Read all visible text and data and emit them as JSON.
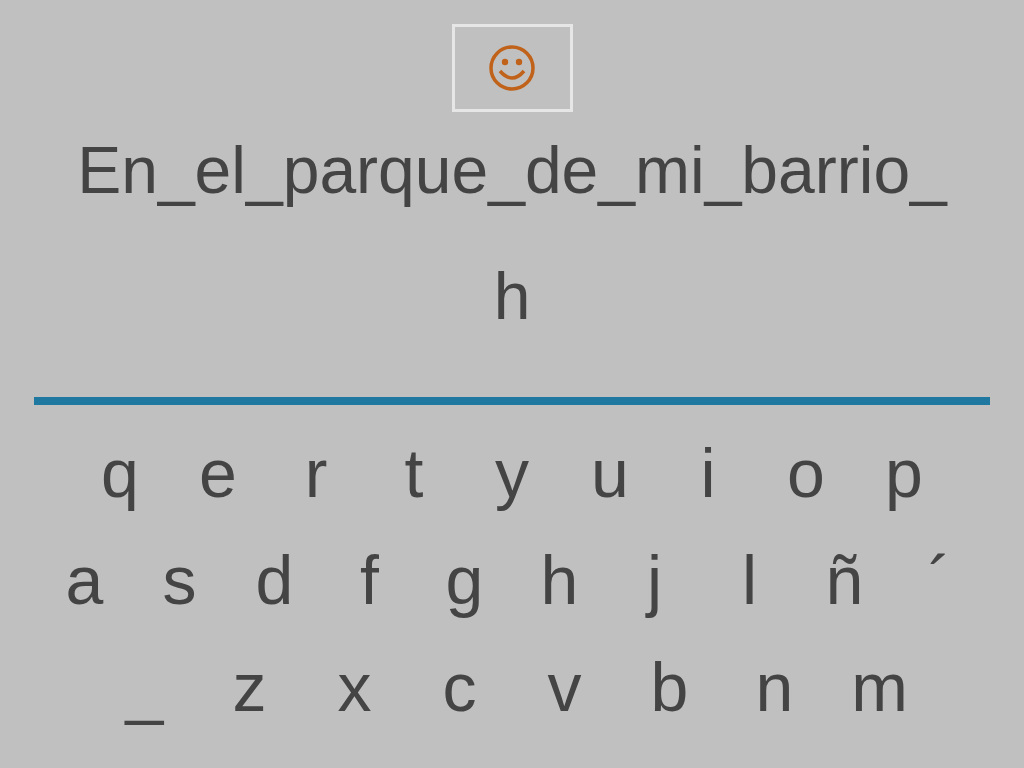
{
  "sentence": "En_el_parque_de_mi_barrio_",
  "answer": "h",
  "keyboard": [
    [
      "q",
      "e",
      "r",
      "t",
      "y",
      "u",
      "i",
      "o",
      "p"
    ],
    [
      "a",
      "s",
      "d",
      "f",
      "g",
      "h",
      "j",
      "l",
      "ñ",
      "´"
    ],
    [
      "_",
      "z",
      "x",
      "c",
      "v",
      "b",
      "n",
      "m"
    ]
  ]
}
